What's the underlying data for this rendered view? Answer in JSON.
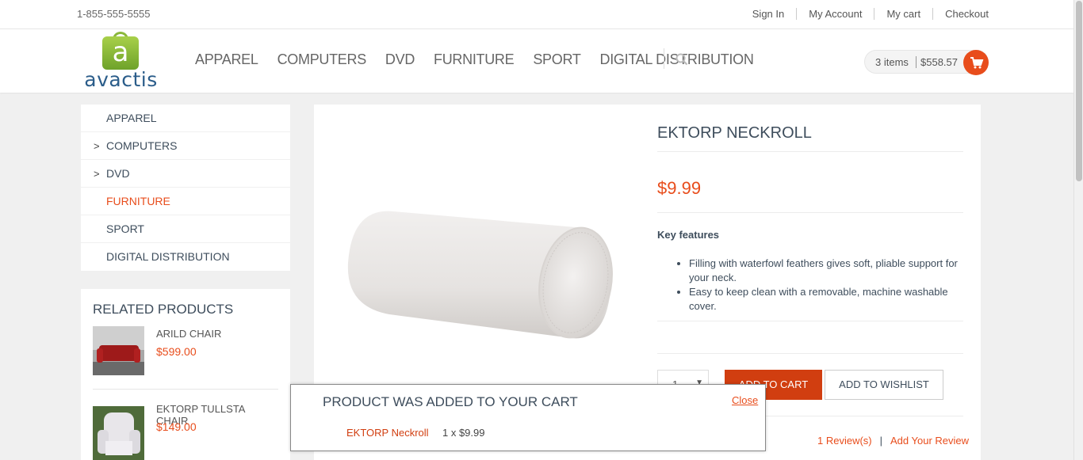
{
  "topbar": {
    "phone": "1-855-555-5555",
    "links": [
      "Sign In",
      "My Account",
      "My cart",
      "Checkout"
    ]
  },
  "logo": {
    "word": "avactis",
    "letter": "a"
  },
  "nav": {
    "items": [
      "APPAREL",
      "COMPUTERS",
      "DVD",
      "FURNITURE",
      "SPORT",
      "DIGITAL DISTRIBUTION"
    ],
    "search_icon": "search-icon"
  },
  "cart": {
    "items": "3 items",
    "total": "$558.57",
    "icon": "cart-icon"
  },
  "sidebar": {
    "items": [
      {
        "label": "APPAREL",
        "chevron": ""
      },
      {
        "label": "COMPUTERS",
        "chevron": ">"
      },
      {
        "label": "DVD",
        "chevron": ">"
      },
      {
        "label": "FURNITURE",
        "chevron": ""
      },
      {
        "label": "SPORT",
        "chevron": ""
      },
      {
        "label": "DIGITAL DISTRIBUTION",
        "chevron": ""
      }
    ],
    "active": "FURNITURE"
  },
  "related": {
    "title": "RELATED PRODUCTS",
    "products": [
      {
        "name": "ARILD CHAIR",
        "price": "$599.00"
      },
      {
        "name": "EKTORP TULLSTA CHAIR",
        "price": "$149.00"
      }
    ]
  },
  "product": {
    "title": "EKTORP NECKROLL",
    "price": "$9.99",
    "features_heading": "Key features",
    "features": [
      "Filling with waterfowl feathers gives soft, pliable support for your neck.",
      "Easy to keep clean with a removable, machine washable cover."
    ],
    "quantity": "1",
    "add_to_cart": "ADD TO CART",
    "add_to_wishlist": "ADD TO WISHLIST",
    "reviews_link": "1 Review(s)",
    "review_sep": "|",
    "add_review": "Add Your Review"
  },
  "popup": {
    "title": "PRODUCT WAS ADDED TO YOUR CART",
    "close": "Close",
    "product_name": "EKTORP Neckroll",
    "qty_price": "1 x $9.99"
  },
  "colors": {
    "accent": "#e84d1c",
    "button": "#d13e10",
    "text": "#3e4d5c"
  }
}
